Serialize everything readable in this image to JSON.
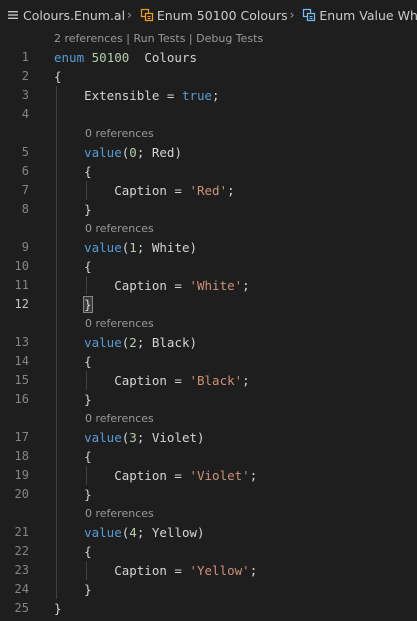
{
  "breadcrumb": {
    "file": "Colours.Enum.al",
    "enum": "Enum 50100 Colours",
    "value": "Enum Value White"
  },
  "codelens": {
    "enum": "2 references | Run Tests | Debug Tests",
    "values": [
      "0 references",
      "0 references",
      "0 references",
      "0 references",
      "0 references"
    ]
  },
  "editor": {
    "current_line": 12,
    "lines": [
      {
        "n": "1",
        "t": [
          [
            "kw",
            "enum "
          ],
          [
            "num",
            "50100"
          ],
          [
            "",
            "  Colours"
          ]
        ]
      },
      {
        "n": "2",
        "t": [
          [
            "",
            "{"
          ]
        ]
      },
      {
        "n": "3",
        "t": [
          [
            "",
            "    Extensible = "
          ],
          [
            "kw",
            "true"
          ],
          [
            "",
            ";"
          ]
        ]
      },
      {
        "n": "4",
        "t": []
      },
      {
        "n": "5",
        "t": [
          [
            "",
            "    "
          ],
          [
            "kw",
            "value"
          ],
          [
            "",
            "("
          ],
          [
            "num",
            "0"
          ],
          [
            "",
            "; Red)"
          ]
        ]
      },
      {
        "n": "6",
        "t": [
          [
            "",
            "    {"
          ]
        ]
      },
      {
        "n": "7",
        "t": [
          [
            "",
            "        Caption = "
          ],
          [
            "str",
            "'Red'"
          ],
          [
            "",
            ";"
          ]
        ]
      },
      {
        "n": "8",
        "t": [
          [
            "",
            "    }"
          ]
        ]
      },
      {
        "n": "9",
        "t": [
          [
            "",
            "    "
          ],
          [
            "kw",
            "value"
          ],
          [
            "",
            "("
          ],
          [
            "num",
            "1"
          ],
          [
            "",
            "; White)"
          ]
        ]
      },
      {
        "n": "10",
        "t": [
          [
            "",
            "    {"
          ]
        ]
      },
      {
        "n": "11",
        "t": [
          [
            "",
            "        Caption = "
          ],
          [
            "str",
            "'White'"
          ],
          [
            "",
            ";"
          ]
        ]
      },
      {
        "n": "12",
        "t": [
          [
            "",
            "    "
          ],
          [
            "box",
            "}"
          ]
        ]
      },
      {
        "n": "13",
        "t": [
          [
            "",
            "    "
          ],
          [
            "kw",
            "value"
          ],
          [
            "",
            "("
          ],
          [
            "num",
            "2"
          ],
          [
            "",
            "; Black)"
          ]
        ]
      },
      {
        "n": "14",
        "t": [
          [
            "",
            "    {"
          ]
        ]
      },
      {
        "n": "15",
        "t": [
          [
            "",
            "        Caption = "
          ],
          [
            "str",
            "'Black'"
          ],
          [
            "",
            ";"
          ]
        ]
      },
      {
        "n": "16",
        "t": [
          [
            "",
            "    }"
          ]
        ]
      },
      {
        "n": "17",
        "t": [
          [
            "",
            "    "
          ],
          [
            "kw",
            "value"
          ],
          [
            "",
            "("
          ],
          [
            "num",
            "3"
          ],
          [
            "",
            "; Violet)"
          ]
        ]
      },
      {
        "n": "18",
        "t": [
          [
            "",
            "    {"
          ]
        ]
      },
      {
        "n": "19",
        "t": [
          [
            "",
            "        Caption = "
          ],
          [
            "str",
            "'Violet'"
          ],
          [
            "",
            ";"
          ]
        ]
      },
      {
        "n": "20",
        "t": [
          [
            "",
            "    }"
          ]
        ]
      },
      {
        "n": "21",
        "t": [
          [
            "",
            "    "
          ],
          [
            "kw",
            "value"
          ],
          [
            "",
            "("
          ],
          [
            "num",
            "4"
          ],
          [
            "",
            "; Yellow)"
          ]
        ]
      },
      {
        "n": "22",
        "t": [
          [
            "",
            "    {"
          ]
        ]
      },
      {
        "n": "23",
        "t": [
          [
            "",
            "        Caption = "
          ],
          [
            "str",
            "'Yellow'"
          ],
          [
            "",
            ";"
          ]
        ]
      },
      {
        "n": "24",
        "t": [
          [
            "",
            "    }"
          ]
        ]
      },
      {
        "n": "25",
        "t": [
          [
            "",
            "}"
          ]
        ]
      }
    ]
  },
  "colors": {
    "background": "#1e1e1e",
    "keyword": "#569cd6",
    "string": "#ce9178",
    "number": "#b5cea8",
    "text": "#d4d4d4",
    "line_number": "#858585"
  },
  "icons": {
    "file": "hamburger-lines-icon",
    "symbol": "enum-icon",
    "separator": "chevron-right-icon"
  }
}
